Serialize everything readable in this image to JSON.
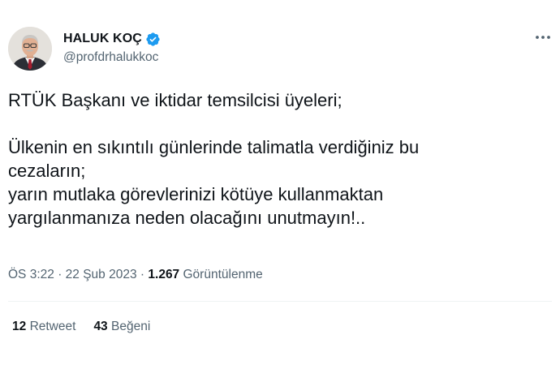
{
  "author": {
    "display_name": "HALUK KOÇ",
    "handle": "@profdrhalukkoc",
    "verified": true,
    "verified_color": "#1d9bf0",
    "avatar_icon": "profile-photo"
  },
  "more_icon": "more-horizontal-icon",
  "tweet": {
    "lines": [
      "RTÜK Başkanı ve iktidar temsilcisi üyeleri;",
      "",
      "Ülkenin en sıkıntılı günlerinde talimatla verdiğiniz bu",
      "cezaların;",
      "yarın mutlaka görevlerinizi kötüye kullanmaktan",
      "yargılanmanıza neden olacağını unutmayın!.."
    ]
  },
  "meta": {
    "time": "ÖS 3:22",
    "separator": "·",
    "date": "22 Şub 2023",
    "views_count": "1.267",
    "views_label": "Görüntülenme"
  },
  "stats": {
    "retweets_count": "12",
    "retweets_label": "Retweet",
    "likes_count": "43",
    "likes_label": "Beğeni"
  },
  "colors": {
    "text": "#0f1419",
    "secondary": "#536471",
    "divider": "#eff3f4"
  }
}
